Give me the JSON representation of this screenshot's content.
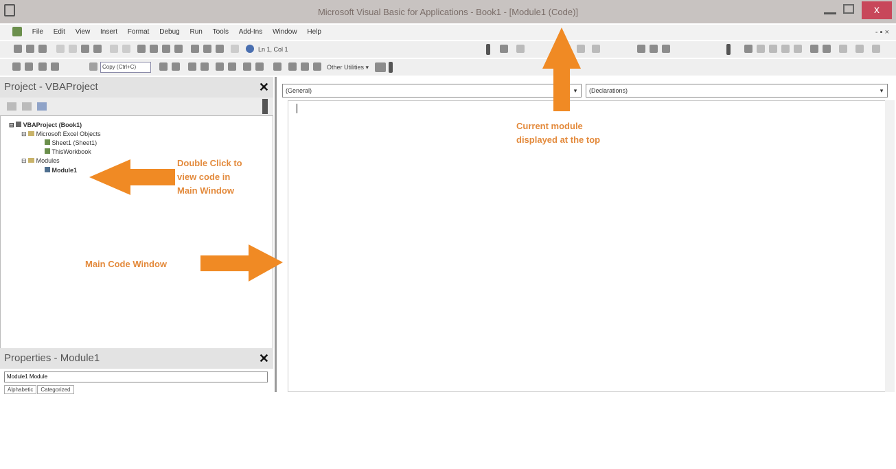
{
  "window": {
    "title": "Microsoft Visual Basic for Applications - Book1 - [Module1 (Code)]",
    "close_glyph": "x"
  },
  "menu": {
    "items": [
      "File",
      "Edit",
      "View",
      "Insert",
      "Format",
      "Debug",
      "Run",
      "Tools",
      "Add-Ins",
      "Window",
      "Help"
    ],
    "mdi_controls": "- ▪ ×"
  },
  "toolbar": {
    "position_label": "Ln 1, Col 1",
    "copy_box": "Copy (Ctrl+C)",
    "other_utilities": "Other Utilities ▾"
  },
  "project_panel": {
    "title": "Project - VBAProject",
    "close_glyph": "✕",
    "tree": [
      {
        "label": "VBAProject (Book1)",
        "level": 0,
        "expander": "⊟"
      },
      {
        "label": "Microsoft Excel Objects",
        "level": 1,
        "expander": "⊟"
      },
      {
        "label": "Sheet1 (Sheet1)",
        "level": 2,
        "expander": ""
      },
      {
        "label": "ThisWorkbook",
        "level": 2,
        "expander": ""
      },
      {
        "label": "Modules",
        "level": 1,
        "expander": "⊟"
      },
      {
        "label": "Module1",
        "level": 2,
        "expander": ""
      }
    ]
  },
  "properties_panel": {
    "title": "Properties - Module1",
    "close_glyph": "✕",
    "object_select": "Module1 Module",
    "tabs": [
      "Alphabetic",
      "Categorized"
    ]
  },
  "code_window": {
    "object_combo": "(General)",
    "procedure_combo": "(Declarations)",
    "dropdown_glyph": "▾"
  },
  "annotations": {
    "double_click": [
      "Double Click to",
      "view code in",
      "Main Window"
    ],
    "current_module": [
      "Current module",
      "displayed at the top"
    ],
    "main_code_window": "Main Code Window"
  },
  "colors": {
    "annotation_orange": "#e38a3c",
    "arrow_orange": "#f08a24",
    "titlebar": "#c8c3c1",
    "close_red": "#c8475a"
  }
}
